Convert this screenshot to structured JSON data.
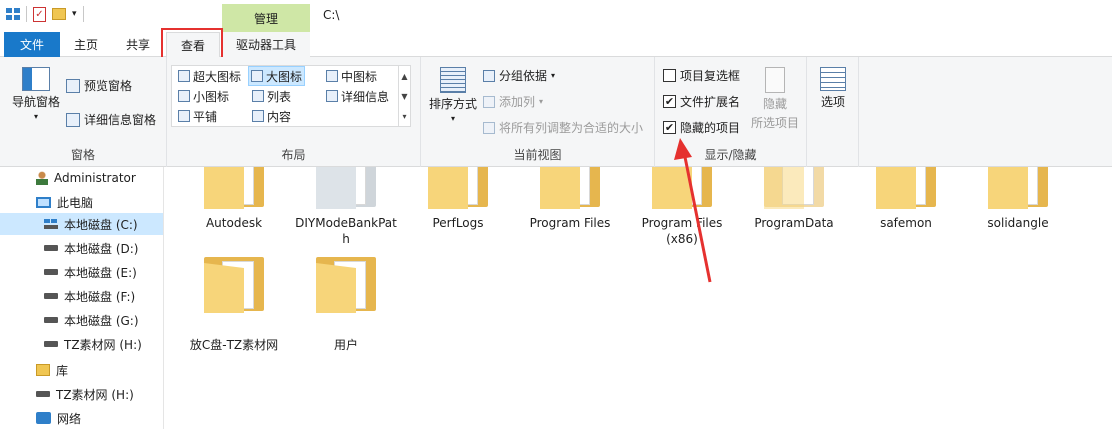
{
  "window": {
    "path": "C:\\"
  },
  "tabs": {
    "file": "文件",
    "home": "主页",
    "share": "共享",
    "view": "查看",
    "manage": "管理",
    "drive_tools": "驱动器工具"
  },
  "ribbon": {
    "panes": {
      "label": "窗格",
      "nav_pane": "导航窗格",
      "preview_pane": "预览窗格",
      "details_pane": "详细信息窗格"
    },
    "layout": {
      "label": "布局",
      "items": [
        "超大图标",
        "大图标",
        "中图标",
        "小图标",
        "列表",
        "详细信息",
        "平铺",
        "内容"
      ],
      "selected": "大图标"
    },
    "current_view": {
      "label": "当前视图",
      "sort_by": "排序方式",
      "group_by": "分组依据",
      "add_column": "添加列",
      "fit_columns": "将所有列调整为合适的大小"
    },
    "show_hide": {
      "label": "显示/隐藏",
      "item_checkboxes": {
        "text": "项目复选框",
        "checked": false
      },
      "file_extensions": {
        "text": "文件扩展名",
        "checked": true
      },
      "hidden_items": {
        "text": "隐藏的项目",
        "checked": true
      },
      "hide_selected_line1": "隐藏",
      "hide_selected_line2": "所选项目"
    },
    "options": "选项"
  },
  "nav": {
    "items": [
      {
        "label": "Administrator",
        "icon": "user-icon"
      },
      {
        "label": "此电脑",
        "icon": "computer-icon"
      },
      {
        "label": "本地磁盘 (C:)",
        "icon": "windows-drive-icon",
        "selected": true
      },
      {
        "label": "本地磁盘 (D:)",
        "icon": "drive-icon"
      },
      {
        "label": "本地磁盘 (E:)",
        "icon": "drive-icon"
      },
      {
        "label": "本地磁盘 (F:)",
        "icon": "drive-icon"
      },
      {
        "label": "本地磁盘 (G:)",
        "icon": "drive-icon"
      },
      {
        "label": "TZ素材网 (H:)",
        "icon": "drive-icon"
      },
      {
        "label": "库",
        "icon": "library-icon"
      },
      {
        "label": "TZ素材网 (H:)",
        "icon": "drive-icon"
      },
      {
        "label": "网络",
        "icon": "network-icon"
      }
    ]
  },
  "folders": [
    {
      "name": "Autodesk"
    },
    {
      "name": "DIYModeBankPath"
    },
    {
      "name": "PerfLogs"
    },
    {
      "name": "Program Files"
    },
    {
      "name": "Program Files (x86)"
    },
    {
      "name": "ProgramData"
    },
    {
      "name": "safemon"
    },
    {
      "name": "solidangle"
    },
    {
      "name": "放C盘-TZ素材网"
    },
    {
      "name": "用户"
    }
  ],
  "colors": {
    "accent": "#1979ca",
    "manage_tab": "#cfe7a6",
    "highlight": "#e5312f",
    "selection": "#cce8ff"
  }
}
